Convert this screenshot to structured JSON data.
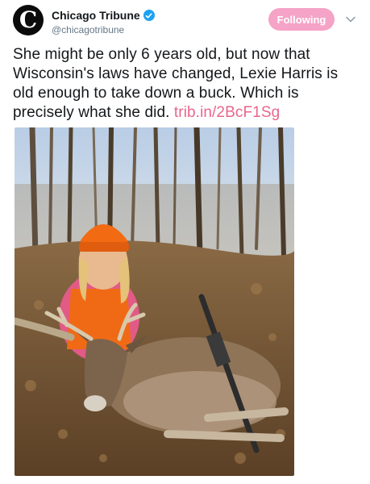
{
  "account": {
    "display_name": "Chicago Tribune",
    "handle": "@chicagotribune",
    "avatar_letter": "C",
    "verified": true
  },
  "follow_button": {
    "label": "Following"
  },
  "tweet": {
    "text": "She might be only 6 years old, but now that Wisconsin's laws have changed, Lexie Harris is old enough to take down a buck. Which is precisely what she did.",
    "link_text": "trib.in/2BcF1Sg"
  },
  "icons": {
    "verified": "verified-badge-icon",
    "menu": "chevron-down-icon"
  },
  "colors": {
    "follow_button": "#f5a3c7",
    "link": "#e0245e",
    "verified": "#1da1f2"
  }
}
